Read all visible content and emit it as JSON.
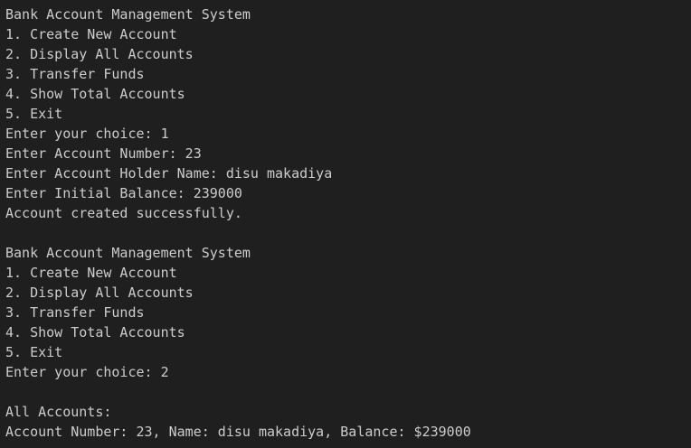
{
  "terminal": {
    "lines": [
      "Bank Account Management System",
      "1. Create New Account",
      "2. Display All Accounts",
      "3. Transfer Funds",
      "4. Show Total Accounts",
      "5. Exit",
      "Enter your choice: 1",
      "Enter Account Number: 23",
      "Enter Account Holder Name: disu makadiya",
      "Enter Initial Balance: 239000",
      "Account created successfully.",
      "",
      "Bank Account Management System",
      "1. Create New Account",
      "2. Display All Accounts",
      "3. Transfer Funds",
      "4. Show Total Accounts",
      "5. Exit",
      "Enter your choice: 2",
      "",
      "All Accounts:",
      "Account Number: 23, Name: disu makadiya, Balance: $239000"
    ]
  },
  "colors": {
    "background": "#1f1f1f",
    "text": "#cccccc"
  }
}
